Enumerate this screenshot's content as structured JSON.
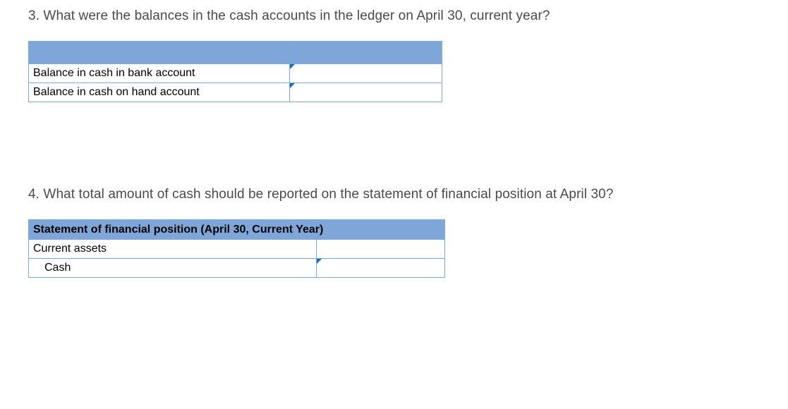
{
  "q3": {
    "prompt": "3. What were the balances in the cash accounts in the ledger on April 30, current year?",
    "rows": [
      {
        "label": "Balance in cash in bank account",
        "value": ""
      },
      {
        "label": "Balance in cash on hand account",
        "value": ""
      }
    ]
  },
  "q4": {
    "prompt": "4. What total amount of cash should be reported on the statement of financial position at April 30?",
    "statement_header": "Statement of financial position (April 30, Current Year)",
    "section_label": "Current assets",
    "line_label": "Cash",
    "line_value": ""
  }
}
